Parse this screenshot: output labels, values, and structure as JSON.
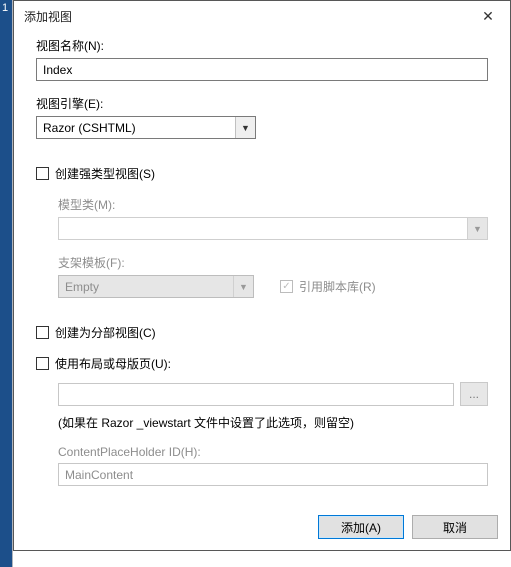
{
  "gutter": {
    "num": "1"
  },
  "dialog": {
    "title": "添加视图",
    "labels": {
      "view_name": "视图名称(N):",
      "view_engine": "视图引擎(E):",
      "create_strong": "创建强类型视图(S)",
      "model_class": "模型类(M):",
      "scaffold": "支架模板(F):",
      "ref_scripts": "引用脚本库(R)",
      "partial": "创建为分部视图(C)",
      "use_layout": "使用布局或母版页(U):",
      "layout_hint": "(如果在 Razor _viewstart 文件中设置了此选项，则留空)",
      "cph_id": "ContentPlaceHolder ID(H):"
    },
    "values": {
      "view_name": "Index",
      "view_engine": "Razor (CSHTML)",
      "model_class": "",
      "scaffold": "Empty",
      "layout_path": "",
      "cph_id": "MainContent"
    },
    "checks": {
      "create_strong": false,
      "ref_scripts": true,
      "partial": false,
      "use_layout": false
    },
    "buttons": {
      "browse": "...",
      "add": "添加(A)",
      "cancel": "取消"
    }
  }
}
